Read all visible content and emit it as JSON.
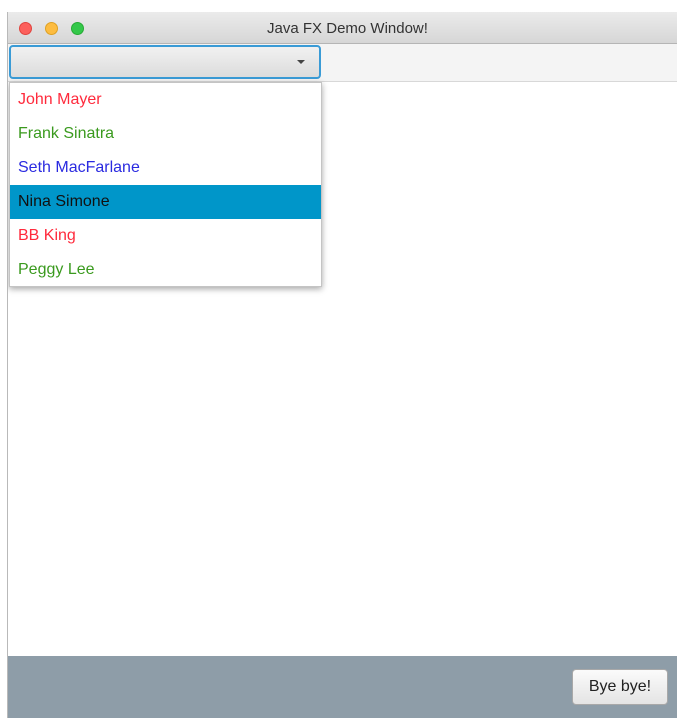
{
  "window": {
    "title": "Java FX Demo Window!"
  },
  "combo": {
    "selected_value": "",
    "accent_color": "#3a9bd6"
  },
  "dropdown": {
    "items": [
      {
        "label": "John Mayer",
        "color": "#ff2a3c"
      },
      {
        "label": "Frank Sinatra",
        "color": "#3a9a1e"
      },
      {
        "label": "Seth MacFarlane",
        "color": "#2a2ae0"
      },
      {
        "label": "Nina Simone",
        "color": "#111111"
      },
      {
        "label": "BB King",
        "color": "#ff2a3c"
      },
      {
        "label": "Peggy Lee",
        "color": "#3a9a1e"
      }
    ],
    "highlighted_index": 3,
    "highlight_color": "#0096c9"
  },
  "footer": {
    "bye_button_label": "Bye bye!",
    "background_color": "#8e9da8"
  }
}
